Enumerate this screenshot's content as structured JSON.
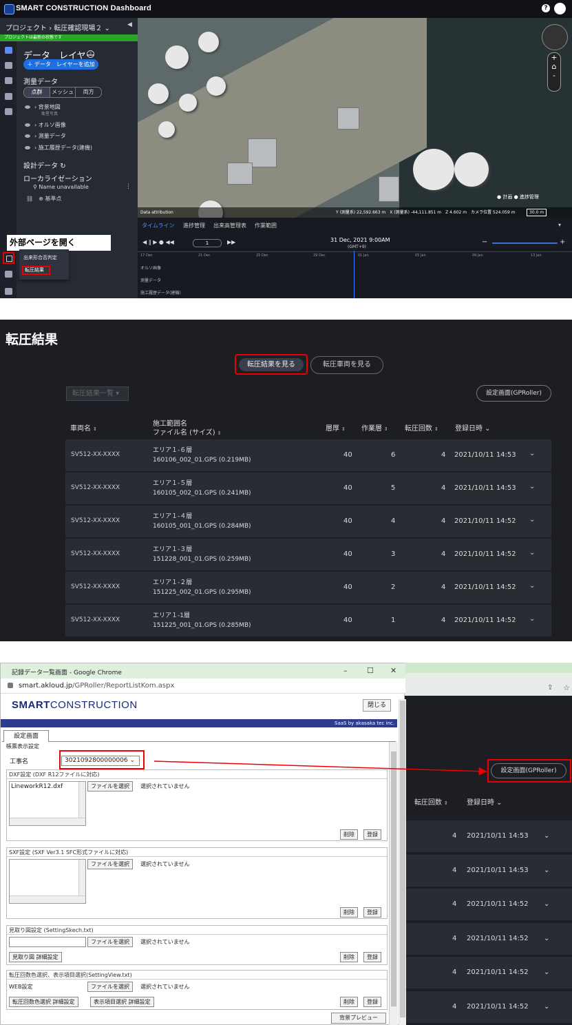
{
  "panel1": {
    "app_title": "SMART CONSTRUCTION Dashboard",
    "breadcrumb": "プロジェクト › 転圧確認現場２ ⌄",
    "status_strip": "プロジェクトは最新の状態です",
    "layer_title": "データ　レイヤー",
    "add_layer_btn": "＋ データ　レイヤーを追加",
    "survey_title": "測量データ",
    "segments": [
      "点群",
      "メッシュ",
      "両方"
    ],
    "tree": [
      {
        "label": "背景地図",
        "sub": "衛星写真"
      },
      {
        "label": "オルソ画像",
        "sub": ""
      },
      {
        "label": "測量データ",
        "sub": ""
      },
      {
        "label": "施工履歴データ(建機)",
        "sub": ""
      }
    ],
    "design_title": "設計データ",
    "local_title": "ローカライゼーション",
    "pin_text": "Name unavailable",
    "base_point": "基準点",
    "callout": "外部ページを開く",
    "popup_items": [
      "出来形合否判定",
      "転圧結果"
    ],
    "map_footer": {
      "attribution": "Data attribution",
      "coords": "Y (測量系) 22,592.663 m　X (測量系) -44,111.851 m　Z 4.602 m　カメラ位置 524.059 m",
      "scale": "30.0 m"
    },
    "plan_toggle": {
      "plan": "計画",
      "progress": "進捗管理"
    },
    "timeline": {
      "tabs": [
        "タイムライン",
        "進捗管理",
        "出来高管理表",
        "作業範囲"
      ],
      "date": "31 Dec, 2021 9:00AM",
      "gmt": "(GMT+9)",
      "speed": "1",
      "ticks": [
        "17 Dec",
        "21 Dec",
        "25 Dec",
        "29 Dec",
        "01 Jan",
        "05 Jan",
        "09 Jan",
        "13 Jan"
      ],
      "rows": [
        "オルソ画像",
        "測量データ",
        "施工履歴データ(建機)"
      ]
    }
  },
  "panel2": {
    "title": "転圧結果",
    "view_results": "転圧結果を見る",
    "view_vehicle": "転圧車両を見る",
    "list_dropdown": "転圧結果一覧 ▾",
    "setting_btn": "設定画面(GPRoller)",
    "headers": {
      "vehicle": "車両名",
      "area": "施工範囲名",
      "file": "ファイル名 (サイズ)",
      "thickness": "層厚",
      "layer": "作業層",
      "count": "転圧回数",
      "date": "登録日時 ⌄"
    },
    "rows": [
      {
        "vehicle": "SV512-XX-XXXX",
        "area": "エリア１-６層",
        "file": "160106_002_01.GPS (0.219MB)",
        "thickness": "40",
        "layer": "6",
        "count": "4",
        "date": "2021/10/11 14:53"
      },
      {
        "vehicle": "SV512-XX-XXXX",
        "area": "エリア１-５層",
        "file": "160105_002_01.GPS (0.241MB)",
        "thickness": "40",
        "layer": "5",
        "count": "4",
        "date": "2021/10/11 14:53"
      },
      {
        "vehicle": "SV512-XX-XXXX",
        "area": "エリア１-４層",
        "file": "160105_001_01.GPS (0.284MB)",
        "thickness": "40",
        "layer": "4",
        "count": "4",
        "date": "2021/10/11 14:52"
      },
      {
        "vehicle": "SV512-XX-XXXX",
        "area": "エリア１-３層",
        "file": "151228_001_01.GPS (0.259MB)",
        "thickness": "40",
        "layer": "3",
        "count": "4",
        "date": "2021/10/11 14:52"
      },
      {
        "vehicle": "SV512-XX-XXXX",
        "area": "エリア１-２層",
        "file": "151225_002_01.GPS (0.295MB)",
        "thickness": "40",
        "layer": "2",
        "count": "4",
        "date": "2021/10/11 14:52"
      },
      {
        "vehicle": "SV512-XX-XXXX",
        "area": "エリア１-1層",
        "file": "151225_001_01.GPS (0.285MB)",
        "thickness": "40",
        "layer": "1",
        "count": "4",
        "date": "2021/10/11 14:52"
      }
    ]
  },
  "panel3": {
    "window_title": "記録データ一覧画面 - Google Chrome",
    "url_host": "smart.akloud.jp",
    "url_path": "/GPRoller/ReportListKom.aspx",
    "logo_bold": "SMART",
    "logo_rest": "CONSTRUCTION",
    "close_btn": "閉じる",
    "saas": "SaaS by akasaka tec inc.",
    "tab": "設定画面",
    "report_group": "帳票表示設定",
    "work_name_label": "工事名",
    "work_name_value": "3021092800000006 ⌄",
    "dxf_group": "DXF設定 (DXF R12ファイルに対応)",
    "dxf_file": "LineworkR12.dxf",
    "choose_file": "ファイルを選択",
    "no_file": "選択されていません",
    "delete": "削除",
    "register": "登録",
    "sxf_group": "SXF設定 (SXF Ver3.1 SFC形式ファイルに対応)",
    "sketch_group": "見取り図設定 (SettingSkech.txt)",
    "sketch_detail": "見取り図 詳細設定",
    "view_group": "転圧回数色選択、表示項目選択(SettingView.txt)",
    "web_setting": "WEB設定",
    "color_detail": "転圧回数色選択 詳細設定",
    "item_detail": "表示項目選択 詳細設定",
    "bg_preview": "背景プレビュー",
    "right_setting_btn": "設定画面(GPRoller)",
    "right_headers": {
      "count": "転圧回数",
      "date": "登録日時 ⌄"
    },
    "right_rows": [
      {
        "count": "4",
        "date": "2021/10/11 14:53"
      },
      {
        "count": "4",
        "date": "2021/10/11 14:53"
      },
      {
        "count": "4",
        "date": "2021/10/11 14:52"
      },
      {
        "count": "4",
        "date": "2021/10/11 14:52"
      },
      {
        "count": "4",
        "date": "2021/10/11 14:52"
      },
      {
        "count": "4",
        "date": "2021/10/11 14:52"
      }
    ]
  }
}
